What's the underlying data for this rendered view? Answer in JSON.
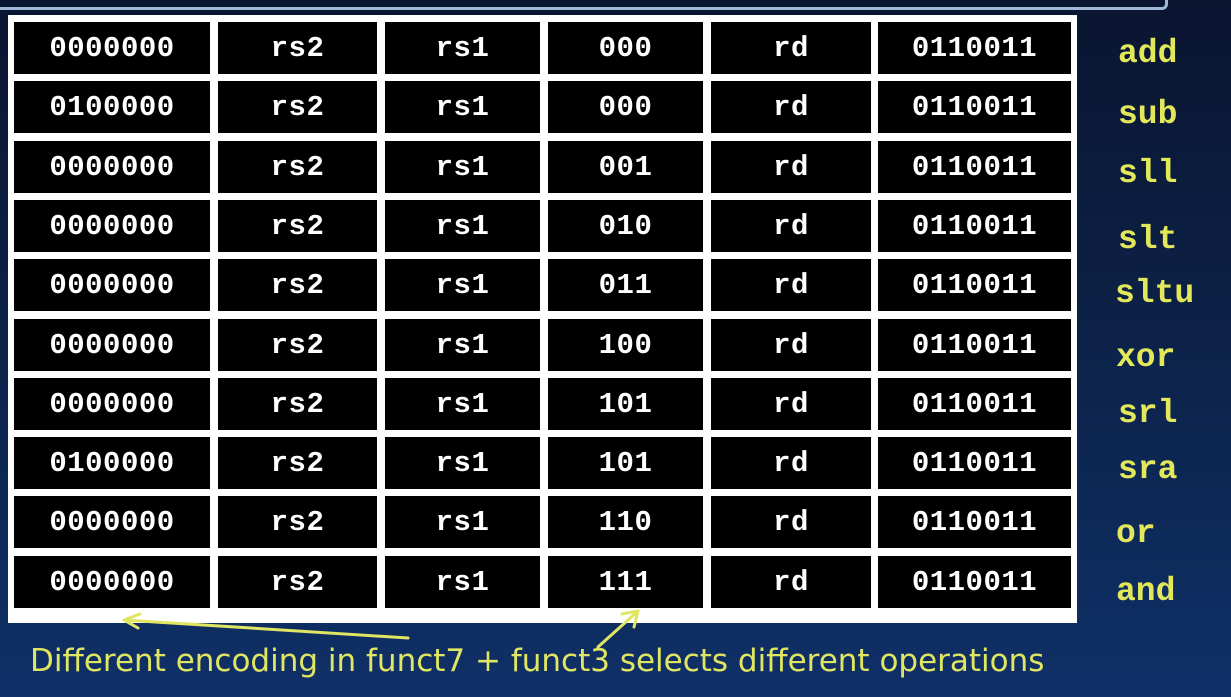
{
  "rows": [
    {
      "funct7": "0000000",
      "rs2": "rs2",
      "rs1": "rs1",
      "funct3": "000",
      "rd": "rd",
      "opcode": "0110011",
      "mnemonic": "add"
    },
    {
      "funct7": "0100000",
      "rs2": "rs2",
      "rs1": "rs1",
      "funct3": "000",
      "rd": "rd",
      "opcode": "0110011",
      "mnemonic": "sub"
    },
    {
      "funct7": "0000000",
      "rs2": "rs2",
      "rs1": "rs1",
      "funct3": "001",
      "rd": "rd",
      "opcode": "0110011",
      "mnemonic": "sll"
    },
    {
      "funct7": "0000000",
      "rs2": "rs2",
      "rs1": "rs1",
      "funct3": "010",
      "rd": "rd",
      "opcode": "0110011",
      "mnemonic": "slt"
    },
    {
      "funct7": "0000000",
      "rs2": "rs2",
      "rs1": "rs1",
      "funct3": "011",
      "rd": "rd",
      "opcode": "0110011",
      "mnemonic": "sltu"
    },
    {
      "funct7": "0000000",
      "rs2": "rs2",
      "rs1": "rs1",
      "funct3": "100",
      "rd": "rd",
      "opcode": "0110011",
      "mnemonic": "xor"
    },
    {
      "funct7": "0000000",
      "rs2": "rs2",
      "rs1": "rs1",
      "funct3": "101",
      "rd": "rd",
      "opcode": "0110011",
      "mnemonic": "srl"
    },
    {
      "funct7": "0100000",
      "rs2": "rs2",
      "rs1": "rs1",
      "funct3": "101",
      "rd": "rd",
      "opcode": "0110011",
      "mnemonic": "sra"
    },
    {
      "funct7": "0000000",
      "rs2": "rs2",
      "rs1": "rs1",
      "funct3": "110",
      "rd": "rd",
      "opcode": "0110011",
      "mnemonic": "or"
    },
    {
      "funct7": "0000000",
      "rs2": "rs2",
      "rs1": "rs1",
      "funct3": "111",
      "rd": "rd",
      "opcode": "0110011",
      "mnemonic": "and"
    }
  ],
  "caption": "Different encoding in funct7 + funct3 selects different operations",
  "colors": {
    "cell_background": "#000000",
    "cell_text": "#ffffff",
    "grid_lines": "#ffffff",
    "accent_yellow": "#e2e85a"
  }
}
